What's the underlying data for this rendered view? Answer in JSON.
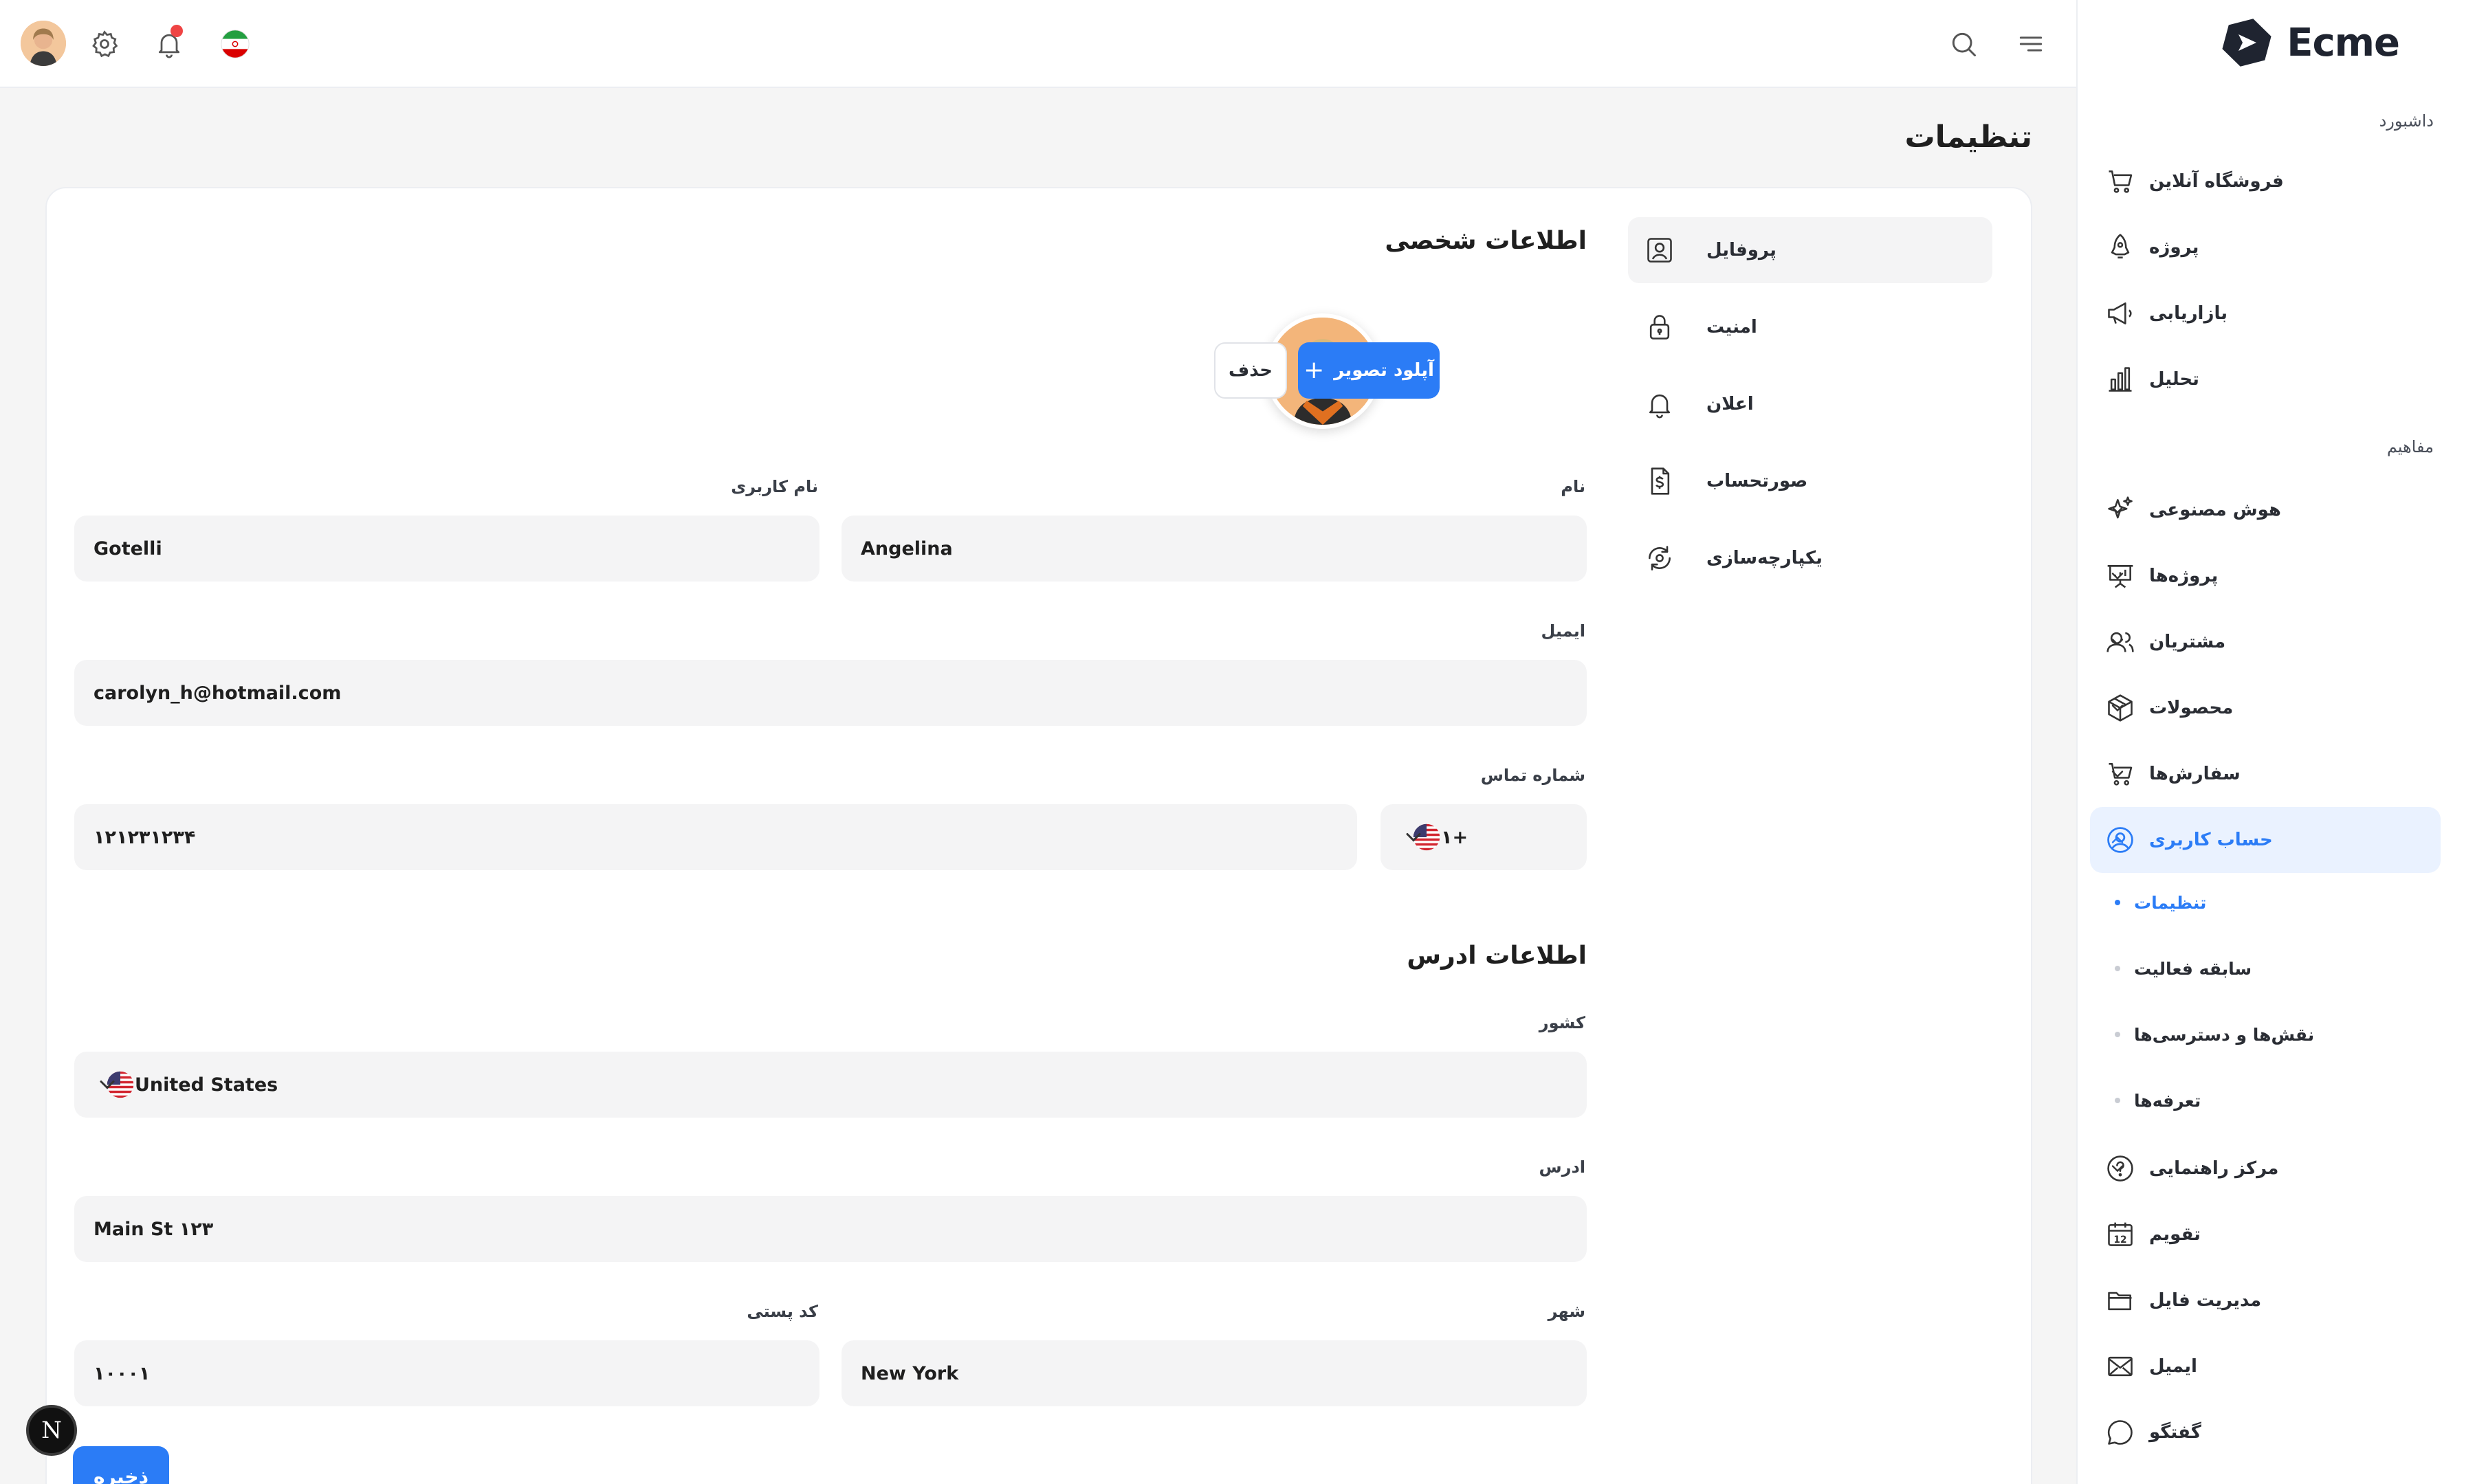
{
  "brand": {
    "name": "Ecme"
  },
  "sidebar": {
    "section_dashboard": "داشبورد",
    "dashboard_items": [
      {
        "label": "فروشگاه آنلاین",
        "icon": "cart-icon"
      },
      {
        "label": "پروژه",
        "icon": "rocket-icon"
      },
      {
        "label": "بازاریابی",
        "icon": "megaphone-icon"
      },
      {
        "label": "تحلیل",
        "icon": "bar-chart-icon"
      }
    ],
    "section_concepts": "مفاهیم",
    "concept_items": [
      {
        "label": "هوش مصنوعی",
        "icon": "sparkles-icon",
        "expanded": false
      },
      {
        "label": "پروژه‌ها",
        "icon": "presentation-icon",
        "expanded": false
      },
      {
        "label": "مشتریان",
        "icon": "users-icon",
        "expanded": false
      },
      {
        "label": "محصولات",
        "icon": "box-icon",
        "expanded": false
      },
      {
        "label": "سفارش‌ها",
        "icon": "cart-icon",
        "expanded": false
      },
      {
        "label": "حساب کاربری",
        "icon": "user-circle-icon",
        "expanded": true,
        "active": true
      }
    ],
    "account_sub_items": [
      {
        "label": "تنظیمات",
        "active": true
      },
      {
        "label": "سابقه فعالیت",
        "active": false
      },
      {
        "label": "نقش‌ها و دسترسی‌ها",
        "active": false
      },
      {
        "label": "تعرفه‌ها",
        "active": false
      }
    ],
    "bottom_items": [
      {
        "label": "مرکز راهنمایی",
        "icon": "help-circle-icon",
        "expandable": true
      },
      {
        "label": "تقویم",
        "icon": "calendar-icon",
        "calendar_day": "12"
      },
      {
        "label": "مدیریت فایل",
        "icon": "folder-icon"
      },
      {
        "label": "ایمیل",
        "icon": "mail-icon"
      },
      {
        "label": "گفتگو",
        "icon": "chat-bubble-icon"
      }
    ]
  },
  "header": {
    "icons": [
      "menu-icon",
      "search-icon",
      "iran-flag-icon",
      "bell-icon",
      "gear-icon",
      "user-avatar"
    ],
    "notification_dot_color": "#ef4444"
  },
  "page": {
    "title": "تنظیمات",
    "settings_nav": [
      {
        "label": "پروفایل",
        "icon": "user-square-icon",
        "active": true
      },
      {
        "label": "امنیت",
        "icon": "lock-icon",
        "active": false
      },
      {
        "label": "اعلان",
        "icon": "bell-icon",
        "active": false
      },
      {
        "label": "صورتحساب",
        "icon": "invoice-dollar-icon",
        "active": false
      },
      {
        "label": "یکپارچه‌سازی",
        "icon": "refresh-icon",
        "active": false
      }
    ],
    "personal_info": {
      "title": "اطلاعات شخصی",
      "upload_label": "آپلود تصویر",
      "delete_label": "حذف",
      "first_name_label": "نام",
      "first_name_value": "Angelina",
      "username_label": "نام کاربری",
      "username_value": "Gotelli",
      "email_label": "ایمیل",
      "email_value": "carolyn_h@hotmail.com",
      "phone_label": "شماره تماس",
      "dial_code": "+۱",
      "phone_value": "۱۲۱۲۳۱۲۳۴"
    },
    "address_info": {
      "title": "اطلاعات ادرس",
      "country_label": "کشور",
      "country_value": "United States",
      "address_label": "ادرس",
      "address_value": "۱۲۳ Main St",
      "city_label": "شهر",
      "city_value": "New York",
      "postal_label": "کد پستی",
      "postal_value": "۱۰۰۰۱"
    },
    "save_label": "ذخیره"
  },
  "colors": {
    "accent": "#2b7cf6",
    "active_bg": "#eaf2ff",
    "field_bg": "#f4f4f5",
    "page_bg": "#f5f5f5"
  },
  "dev_badge": "N"
}
